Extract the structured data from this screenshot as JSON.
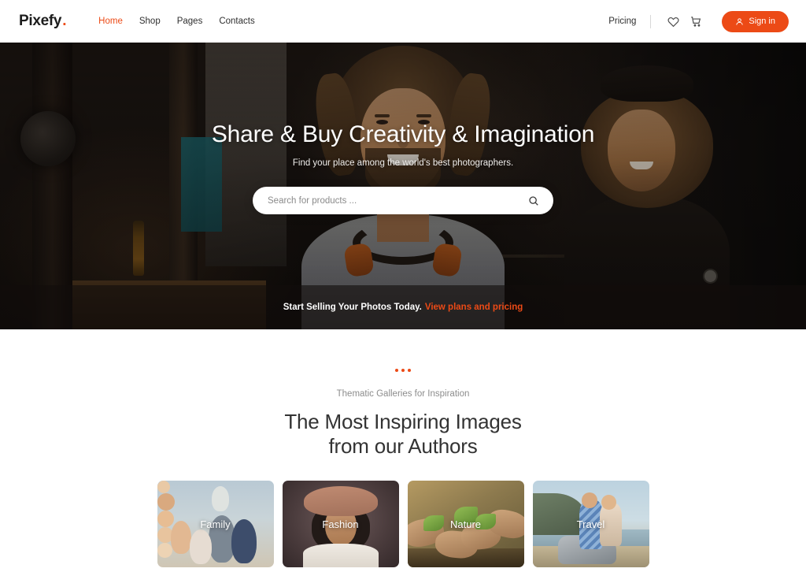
{
  "header": {
    "logo": "Pixefy",
    "logo_dot": ".",
    "nav": [
      {
        "label": "Home",
        "active": true
      },
      {
        "label": "Shop",
        "active": false
      },
      {
        "label": "Pages",
        "active": false
      },
      {
        "label": "Contacts",
        "active": false
      }
    ],
    "pricing_label": "Pricing",
    "wishlist_icon": "heart-icon",
    "cart_icon": "cart-icon",
    "signin_label": "Sign in",
    "signin_icon": "user-icon",
    "accent_color": "#ec4a16"
  },
  "hero": {
    "title": "Share & Buy Creativity & Imagination",
    "subtitle": "Find your place among the world's best photographers.",
    "search": {
      "placeholder": "Search for products ...",
      "value": "",
      "icon": "search-icon"
    },
    "banner": {
      "text": "Start Selling Your Photos Today.",
      "link_label": "View plans and pricing",
      "link_color": "#ec4a16"
    }
  },
  "galleries": {
    "eyebrow": "Thematic Galleries for Inspiration",
    "title_line1": "The Most Inspiring Images",
    "title_line2": "from our Authors",
    "dot_color": "#ec4a16",
    "cards": [
      {
        "label": "Family"
      },
      {
        "label": "Fashion"
      },
      {
        "label": "Nature"
      },
      {
        "label": "Travel"
      }
    ]
  }
}
